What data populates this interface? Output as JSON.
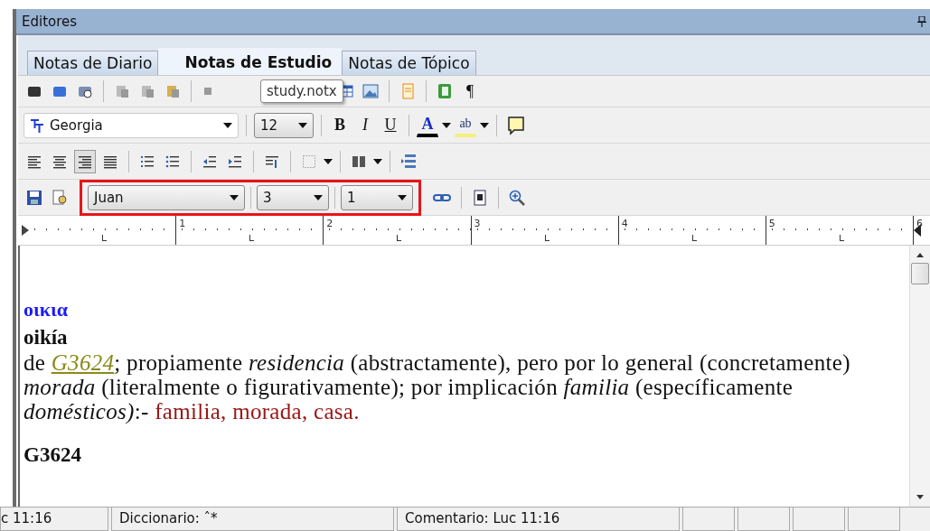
{
  "window": {
    "title": "Editores"
  },
  "tabs": [
    {
      "label": "Notas de Diario",
      "selected": false
    },
    {
      "label": "Notas de Estudio",
      "selected": true
    },
    {
      "label": "Notas de Tópico",
      "selected": false
    }
  ],
  "tooltip": "study.notx",
  "format_bar": {
    "font": "Georgia",
    "size": "12",
    "bold": "B",
    "italic": "I",
    "underline": "U",
    "font_color": "A",
    "highlight": "ab",
    "pilcrow": "¶"
  },
  "alignment": [
    {
      "kind": "left",
      "selected": false
    },
    {
      "kind": "center",
      "selected": false
    },
    {
      "kind": "right",
      "selected": true
    },
    {
      "kind": "justify",
      "selected": false
    }
  ],
  "reference": {
    "book": "Juan",
    "chapter": "3",
    "verse": "1"
  },
  "ruler_marks": [
    "1",
    "2",
    "3",
    "4",
    "5",
    "6"
  ],
  "entry": {
    "greek": "οικια",
    "transliteration": "oikía",
    "definition": [
      {
        "kind": "text",
        "text": "de "
      },
      {
        "kind": "link",
        "text": "G3624"
      },
      {
        "kind": "rich",
        "text": "; propiamente *residencia* (abstractamente), pero por lo general (concretamente) *morada* (literalmente o figurativamente); por implicación *familia* (específicamente *domésticos)*:- "
      },
      {
        "kind": "translation",
        "text": "familia, morada, casa."
      }
    ],
    "next_heading": "G3624"
  },
  "status_bar": [
    "c 11:16",
    "Diccionario: ˆ*",
    "Comentario: Luc 11:16"
  ]
}
